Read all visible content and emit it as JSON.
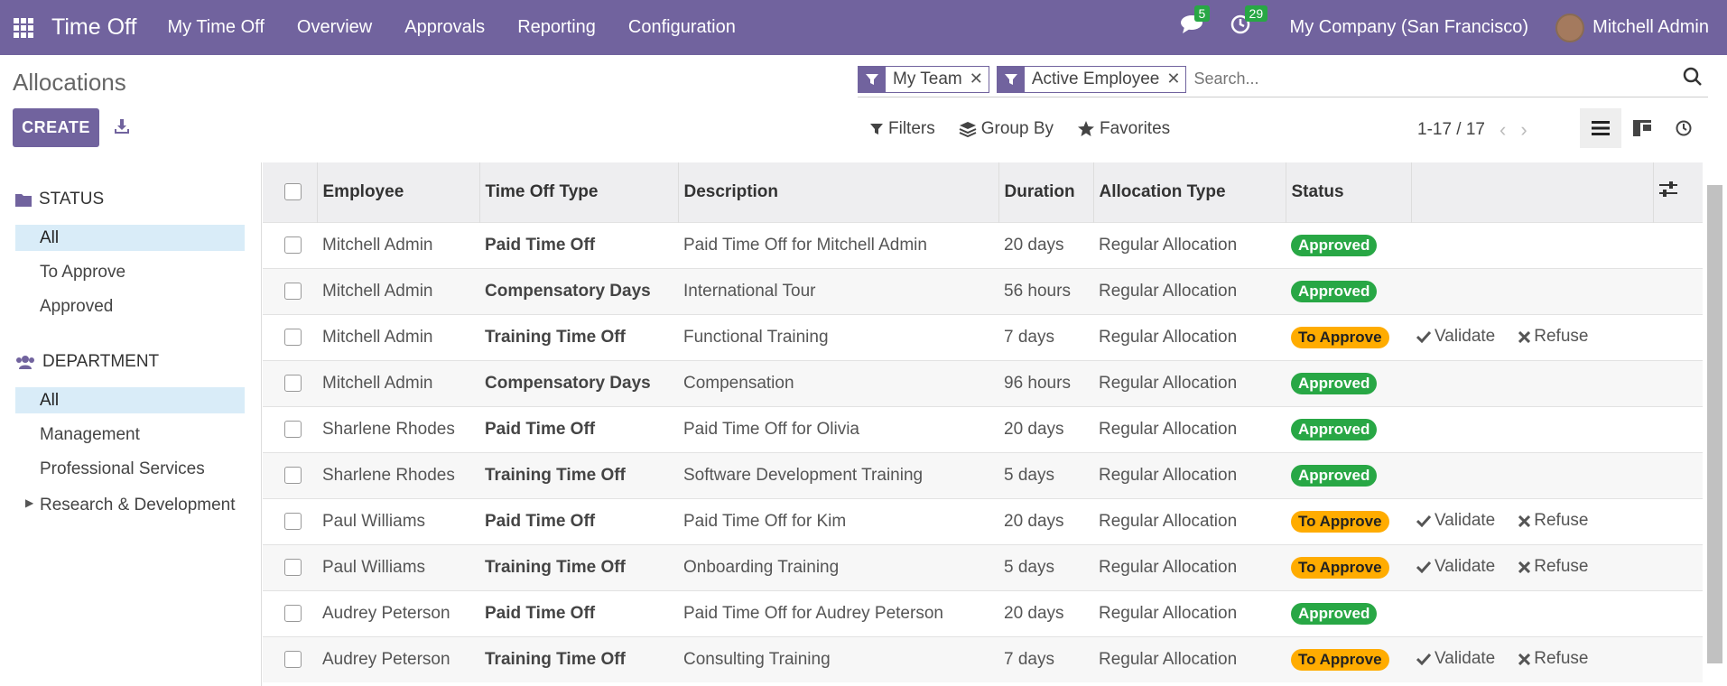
{
  "navbar": {
    "app_name": "Time Off",
    "items": [
      "My Time Off",
      "Overview",
      "Approvals",
      "Reporting",
      "Configuration"
    ],
    "messages_count": "5",
    "activities_count": "29",
    "company": "My Company (San Francisco)",
    "user": "Mitchell Admin"
  },
  "control": {
    "breadcrumb": "Allocations",
    "create_label": "CREATE",
    "facets": [
      "My Team",
      "Active Employee"
    ],
    "search_placeholder": "Search...",
    "filters_label": "Filters",
    "groupby_label": "Group By",
    "favorites_label": "Favorites",
    "pager": "1-17 / 17"
  },
  "sidebar": {
    "status_header": "STATUS",
    "status_items": [
      "All",
      "To Approve",
      "Approved"
    ],
    "department_header": "DEPARTMENT",
    "department_items": [
      "All",
      "Management",
      "Professional Services",
      "Research & Development"
    ]
  },
  "table": {
    "columns": [
      "Employee",
      "Time Off Type",
      "Description",
      "Duration",
      "Allocation Type",
      "Status"
    ],
    "validate_label": "Validate",
    "refuse_label": "Refuse",
    "rows": [
      {
        "employee": "Mitchell Admin",
        "type": "Paid Time Off",
        "description": "Paid Time Off for Mitchell Admin",
        "duration": "20 days",
        "allocation": "Regular Allocation",
        "status": "Approved"
      },
      {
        "employee": "Mitchell Admin",
        "type": "Compensatory Days",
        "description": "International Tour",
        "duration": "56 hours",
        "allocation": "Regular Allocation",
        "status": "Approved"
      },
      {
        "employee": "Mitchell Admin",
        "type": "Training Time Off",
        "description": "Functional Training",
        "duration": "7 days",
        "allocation": "Regular Allocation",
        "status": "To Approve"
      },
      {
        "employee": "Mitchell Admin",
        "type": "Compensatory Days",
        "description": "Compensation",
        "duration": "96 hours",
        "allocation": "Regular Allocation",
        "status": "Approved"
      },
      {
        "employee": "Sharlene Rhodes",
        "type": "Paid Time Off",
        "description": "Paid Time Off for Olivia",
        "duration": "20 days",
        "allocation": "Regular Allocation",
        "status": "Approved"
      },
      {
        "employee": "Sharlene Rhodes",
        "type": "Training Time Off",
        "description": "Software Development Training",
        "duration": "5 days",
        "allocation": "Regular Allocation",
        "status": "Approved"
      },
      {
        "employee": "Paul Williams",
        "type": "Paid Time Off",
        "description": "Paid Time Off for Kim",
        "duration": "20 days",
        "allocation": "Regular Allocation",
        "status": "To Approve"
      },
      {
        "employee": "Paul Williams",
        "type": "Training Time Off",
        "description": "Onboarding Training",
        "duration": "5 days",
        "allocation": "Regular Allocation",
        "status": "To Approve"
      },
      {
        "employee": "Audrey Peterson",
        "type": "Paid Time Off",
        "description": "Paid Time Off for Audrey Peterson",
        "duration": "20 days",
        "allocation": "Regular Allocation",
        "status": "Approved"
      },
      {
        "employee": "Audrey Peterson",
        "type": "Training Time Off",
        "description": "Consulting Training",
        "duration": "7 days",
        "allocation": "Regular Allocation",
        "status": "To Approve"
      }
    ]
  },
  "colors": {
    "brand": "#71639e",
    "approved": "#28a745",
    "to_approve": "#ffac00",
    "sidebar_active": "#d9ecf8"
  }
}
